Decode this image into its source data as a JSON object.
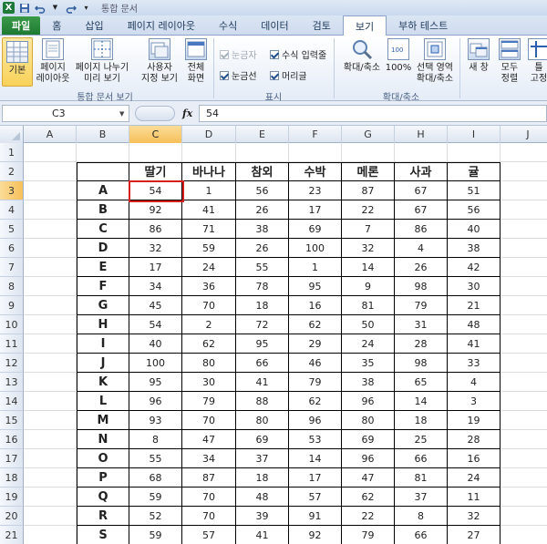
{
  "titlebar": {
    "title": "통합 문서"
  },
  "tabs": [
    {
      "label": "파일",
      "kind": "file"
    },
    {
      "label": "홈"
    },
    {
      "label": "삽입"
    },
    {
      "label": "페이지 레이아웃"
    },
    {
      "label": "수식"
    },
    {
      "label": "데이터"
    },
    {
      "label": "검토"
    },
    {
      "label": "보기",
      "active": true
    },
    {
      "label": "부하 테스트"
    }
  ],
  "ribbon": {
    "groups": {
      "workbook_views": "통합 문서 보기",
      "show": "표시",
      "zoom": "확대/축소"
    },
    "buttons": {
      "normal": "기본",
      "page_layout_1": "페이지",
      "page_layout_2": "레이아웃",
      "page_break_1": "페이지 나누기",
      "page_break_2": "미리 보기",
      "custom_1": "사용자",
      "custom_2": "지정 보기",
      "full_1": "전체",
      "full_2": "화면",
      "zoom": "확대/축소",
      "zoom100": "100%",
      "zoom_sel_1": "선택 영역",
      "zoom_sel_2": "확대/축소",
      "new_window": "새 창",
      "arrange_1": "모두",
      "arrange_2": "정렬",
      "freeze_1": "틀",
      "freeze_2": "고정"
    },
    "checks": {
      "ruler": "눈금자",
      "formula_bar": "수식 입력줄",
      "gridlines": "눈금선",
      "headings": "머리글"
    }
  },
  "formula_bar": {
    "name_box": "C3",
    "value": "54"
  },
  "columns": [
    "A",
    "B",
    "C",
    "D",
    "E",
    "F",
    "G",
    "H",
    "I",
    "J"
  ],
  "rows": [
    "1",
    "2",
    "3",
    "4",
    "5",
    "6",
    "7",
    "8",
    "9",
    "10",
    "11",
    "12",
    "13",
    "14",
    "15",
    "16",
    "17",
    "18",
    "19",
    "20",
    "21"
  ],
  "table": {
    "headers": [
      "딸기",
      "바나나",
      "참외",
      "수박",
      "메론",
      "사과",
      "귤"
    ],
    "rows": [
      {
        "label": "A",
        "values": [
          "54",
          "1",
          "56",
          "23",
          "87",
          "67",
          "51"
        ]
      },
      {
        "label": "B",
        "values": [
          "92",
          "41",
          "26",
          "17",
          "22",
          "67",
          "56"
        ]
      },
      {
        "label": "C",
        "values": [
          "86",
          "71",
          "38",
          "69",
          "7",
          "86",
          "40"
        ]
      },
      {
        "label": "D",
        "values": [
          "32",
          "59",
          "26",
          "100",
          "32",
          "4",
          "38"
        ]
      },
      {
        "label": "E",
        "values": [
          "17",
          "24",
          "55",
          "1",
          "14",
          "26",
          "42"
        ]
      },
      {
        "label": "F",
        "values": [
          "34",
          "36",
          "78",
          "95",
          "9",
          "98",
          "30"
        ]
      },
      {
        "label": "G",
        "values": [
          "45",
          "70",
          "18",
          "16",
          "81",
          "79",
          "21"
        ]
      },
      {
        "label": "H",
        "values": [
          "54",
          "2",
          "72",
          "62",
          "50",
          "31",
          "48"
        ]
      },
      {
        "label": "I",
        "values": [
          "40",
          "62",
          "95",
          "29",
          "24",
          "28",
          "41"
        ]
      },
      {
        "label": "J",
        "values": [
          "100",
          "80",
          "66",
          "46",
          "35",
          "98",
          "33"
        ]
      },
      {
        "label": "K",
        "values": [
          "95",
          "30",
          "41",
          "79",
          "38",
          "65",
          "4"
        ]
      },
      {
        "label": "L",
        "values": [
          "96",
          "79",
          "88",
          "62",
          "96",
          "14",
          "3"
        ]
      },
      {
        "label": "M",
        "values": [
          "93",
          "70",
          "80",
          "96",
          "80",
          "18",
          "19"
        ]
      },
      {
        "label": "N",
        "values": [
          "8",
          "47",
          "69",
          "53",
          "69",
          "25",
          "28"
        ]
      },
      {
        "label": "O",
        "values": [
          "55",
          "34",
          "37",
          "14",
          "96",
          "66",
          "16"
        ]
      },
      {
        "label": "P",
        "values": [
          "68",
          "87",
          "18",
          "17",
          "47",
          "81",
          "24"
        ]
      },
      {
        "label": "Q",
        "values": [
          "59",
          "70",
          "48",
          "57",
          "62",
          "37",
          "11"
        ]
      },
      {
        "label": "R",
        "values": [
          "52",
          "70",
          "39",
          "91",
          "22",
          "8",
          "32"
        ]
      },
      {
        "label": "S",
        "values": [
          "59",
          "57",
          "41",
          "92",
          "79",
          "66",
          "27"
        ]
      }
    ]
  },
  "selected_cell": "C3"
}
